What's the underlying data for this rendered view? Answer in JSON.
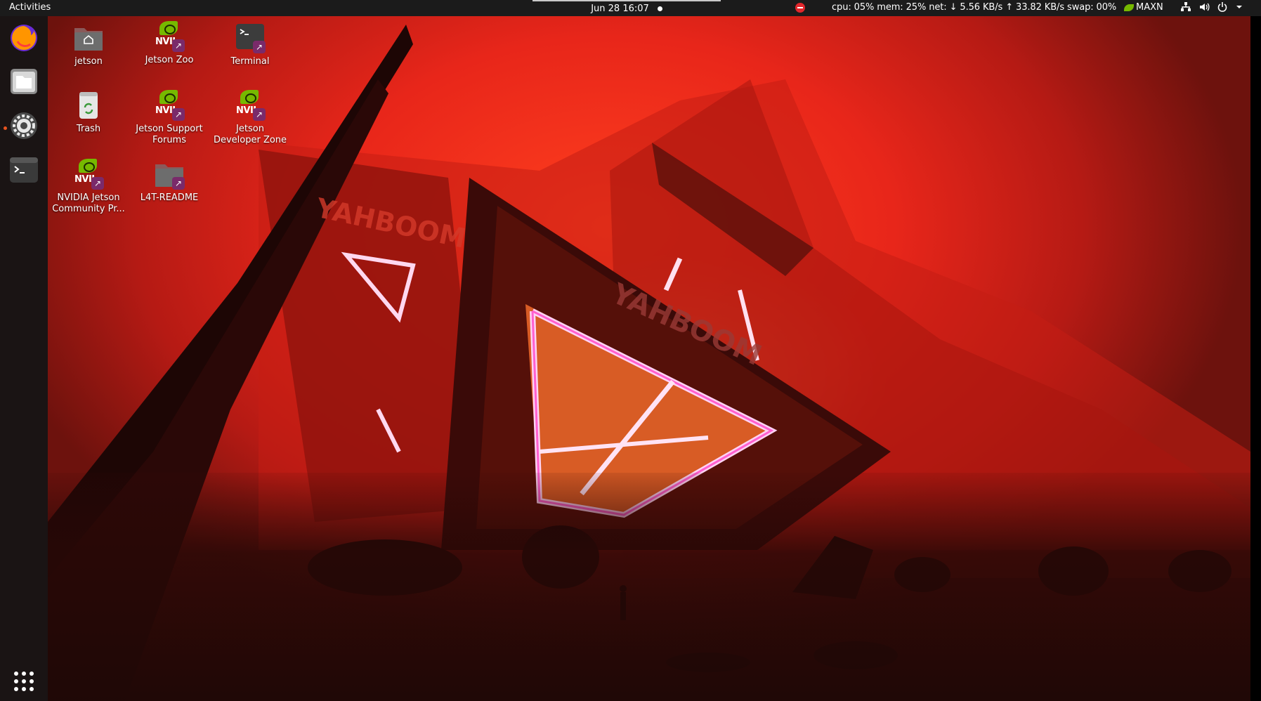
{
  "topbar": {
    "activities_label": "Activities",
    "clock": "Jun 28  16:07",
    "sysmon": "cpu: 05% mem: 25% net: ↓  5.56 KB/s ↑  33.82 KB/s swap: 00%",
    "power_mode": "MAXN",
    "tray_icons": [
      "network-icon",
      "volume-icon",
      "power-icon",
      "chevron-down-icon"
    ]
  },
  "dock": {
    "items": [
      {
        "name": "firefox",
        "running": false
      },
      {
        "name": "files",
        "running": false
      },
      {
        "name": "settings",
        "running": true
      },
      {
        "name": "terminal",
        "running": false
      }
    ],
    "show_apps_icon": "app-grid-icon"
  },
  "desktop": {
    "icons": [
      {
        "label": "jetson",
        "type": "home-folder"
      },
      {
        "label": "Jetson Zoo",
        "type": "nvidia-link"
      },
      {
        "label": "Terminal",
        "type": "terminal-link"
      },
      {
        "label": "Trash",
        "type": "trash"
      },
      {
        "label": "Jetson Support Forums",
        "type": "nvidia-link"
      },
      {
        "label": "Jetson Developer Zone",
        "type": "nvidia-link"
      },
      {
        "label": "NVIDIA Jetson Community Pr...",
        "type": "nvidia-link"
      },
      {
        "label": "L4T-README",
        "type": "folder-link"
      }
    ],
    "nvidia_glyph_text": "NVIL"
  },
  "wallpaper": {
    "banner_text": "YAHBOOM",
    "colors": {
      "primary": "#e8261a",
      "glow": "#ff9a5a",
      "neon": "#ff7ad9"
    }
  }
}
